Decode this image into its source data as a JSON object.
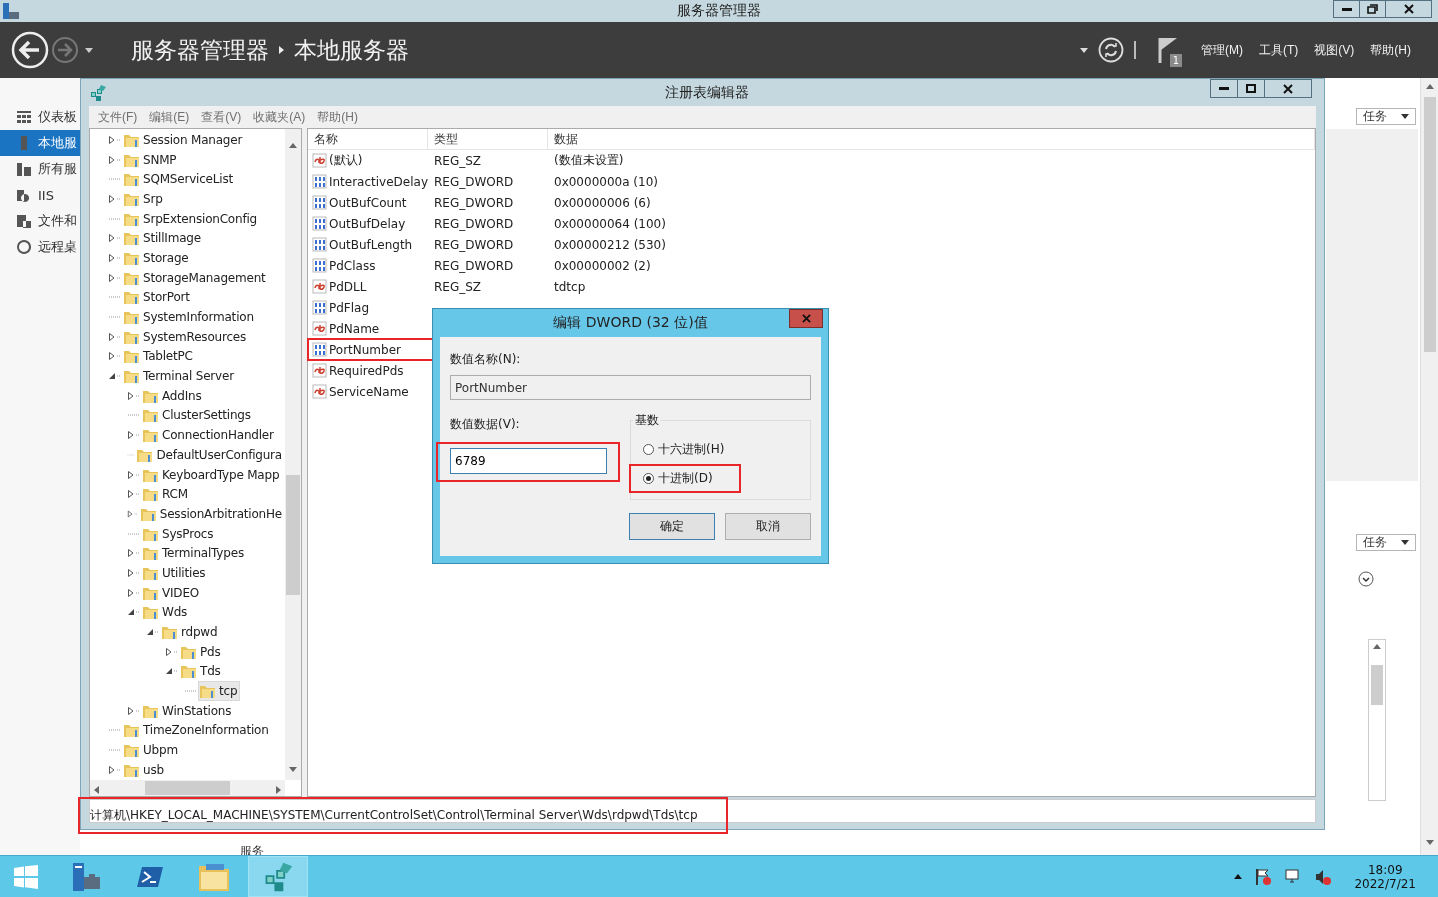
{
  "server_manager": {
    "title": "服务器管理器",
    "breadcrumb": [
      "服务器管理器",
      "本地服务器"
    ],
    "notifications": "1",
    "menu": [
      "管理(M)",
      "工具(T)",
      "视图(V)",
      "帮助(H)"
    ],
    "nav": [
      {
        "label": "仪表板",
        "kind": "dashboard",
        "selected": false
      },
      {
        "label": "本地服",
        "kind": "local",
        "selected": true
      },
      {
        "label": "所有服",
        "kind": "all",
        "selected": false
      },
      {
        "label": "IIS",
        "kind": "iis",
        "selected": false
      },
      {
        "label": "文件和",
        "kind": "files",
        "selected": false
      },
      {
        "label": "远程桌",
        "kind": "remote",
        "selected": false
      }
    ],
    "task_buttons": [
      "任务",
      "任务"
    ],
    "section_label": "服务"
  },
  "regedit": {
    "title": "注册表编辑器",
    "menu": [
      "文件(F)",
      "编辑(E)",
      "查看(V)",
      "收藏夹(A)",
      "帮助(H)"
    ],
    "tree": [
      {
        "name": "Session Manager",
        "has_children": true,
        "expanded": false,
        "selected": false
      },
      {
        "name": "SNMP",
        "has_children": true,
        "expanded": false,
        "selected": false
      },
      {
        "name": "SQMServiceList",
        "has_children": false,
        "expanded": false,
        "selected": false
      },
      {
        "name": "Srp",
        "has_children": true,
        "expanded": false,
        "selected": false
      },
      {
        "name": "SrpExtensionConfig",
        "has_children": false,
        "expanded": false,
        "selected": false
      },
      {
        "name": "StillImage",
        "has_children": true,
        "expanded": false,
        "selected": false
      },
      {
        "name": "Storage",
        "has_children": true,
        "expanded": false,
        "selected": false
      },
      {
        "name": "StorageManagement",
        "has_children": true,
        "expanded": false,
        "selected": false
      },
      {
        "name": "StorPort",
        "has_children": false,
        "expanded": false,
        "selected": false
      },
      {
        "name": "SystemInformation",
        "has_children": false,
        "expanded": false,
        "selected": false
      },
      {
        "name": "SystemResources",
        "has_children": true,
        "expanded": false,
        "selected": false
      },
      {
        "name": "TabletPC",
        "has_children": true,
        "expanded": false,
        "selected": false
      },
      {
        "name": "Terminal Server",
        "has_children": true,
        "expanded": true,
        "selected": false,
        "children": [
          {
            "name": "AddIns",
            "has_children": true,
            "expanded": false,
            "selected": false
          },
          {
            "name": "ClusterSettings",
            "has_children": false,
            "expanded": false,
            "selected": false
          },
          {
            "name": "ConnectionHandler",
            "has_children": true,
            "expanded": false,
            "selected": false
          },
          {
            "name": "DefaultUserConfigura",
            "has_children": false,
            "expanded": false,
            "selected": false
          },
          {
            "name": "KeyboardType Mapp",
            "has_children": true,
            "expanded": false,
            "selected": false
          },
          {
            "name": "RCM",
            "has_children": true,
            "expanded": false,
            "selected": false
          },
          {
            "name": "SessionArbitrationHe",
            "has_children": true,
            "expanded": false,
            "selected": false
          },
          {
            "name": "SysProcs",
            "has_children": false,
            "expanded": false,
            "selected": false
          },
          {
            "name": "TerminalTypes",
            "has_children": true,
            "expanded": false,
            "selected": false
          },
          {
            "name": "Utilities",
            "has_children": true,
            "expanded": false,
            "selected": false
          },
          {
            "name": "VIDEO",
            "has_children": true,
            "expanded": false,
            "selected": false
          },
          {
            "name": "Wds",
            "has_children": true,
            "expanded": true,
            "selected": false,
            "children": [
              {
                "name": "rdpwd",
                "has_children": true,
                "expanded": true,
                "selected": false,
                "children": [
                  {
                    "name": "Pds",
                    "has_children": true,
                    "expanded": false,
                    "selected": false
                  },
                  {
                    "name": "Tds",
                    "has_children": true,
                    "expanded": true,
                    "selected": false,
                    "children": [
                      {
                        "name": "tcp",
                        "has_children": false,
                        "expanded": false,
                        "selected": true
                      }
                    ]
                  }
                ]
              }
            ]
          },
          {
            "name": "WinStations",
            "has_children": true,
            "expanded": false,
            "selected": false
          }
        ]
      },
      {
        "name": "TimeZoneInformation",
        "has_children": false,
        "expanded": false,
        "selected": false
      },
      {
        "name": "Ubpm",
        "has_children": false,
        "expanded": false,
        "selected": false
      },
      {
        "name": "usb",
        "has_children": true,
        "expanded": false,
        "selected": false
      }
    ],
    "columns": [
      "名称",
      "类型",
      "数据"
    ],
    "values": [
      {
        "name": "(默认)",
        "kind": "string",
        "type": "REG_SZ",
        "data": "(数值未设置)",
        "highlighted": false
      },
      {
        "name": "InteractiveDelay",
        "kind": "dword",
        "type": "REG_DWORD",
        "data": "0x0000000a (10)",
        "highlighted": false
      },
      {
        "name": "OutBufCount",
        "kind": "dword",
        "type": "REG_DWORD",
        "data": "0x00000006 (6)",
        "highlighted": false
      },
      {
        "name": "OutBufDelay",
        "kind": "dword",
        "type": "REG_DWORD",
        "data": "0x00000064 (100)",
        "highlighted": false
      },
      {
        "name": "OutBufLength",
        "kind": "dword",
        "type": "REG_DWORD",
        "data": "0x00000212 (530)",
        "highlighted": false
      },
      {
        "name": "PdClass",
        "kind": "dword",
        "type": "REG_DWORD",
        "data": "0x00000002 (2)",
        "highlighted": false
      },
      {
        "name": "PdDLL",
        "kind": "string",
        "type": "REG_SZ",
        "data": "tdtcp",
        "highlighted": false
      },
      {
        "name": "PdFlag",
        "kind": "dword",
        "highlighted": false
      },
      {
        "name": "PdName",
        "kind": "string",
        "highlighted": false
      },
      {
        "name": "PortNumber",
        "kind": "dword",
        "highlighted": true
      },
      {
        "name": "RequiredPds",
        "kind": "string",
        "highlighted": false
      },
      {
        "name": "ServiceName",
        "kind": "string",
        "highlighted": false
      }
    ],
    "path": "计算机\\HKEY_LOCAL_MACHINE\\SYSTEM\\CurrentControlSet\\Control\\Terminal Server\\Wds\\rdpwd\\Tds\\tcp",
    "path_highlighted": true
  },
  "dialog": {
    "title": "编辑 DWORD (32 位)值",
    "name_label": "数值名称(N):",
    "name_value": "PortNumber",
    "data_label": "数值数据(V):",
    "data_value": "6789",
    "data_highlighted": true,
    "base_label": "基数",
    "bases": [
      {
        "label": "十六进制(H)",
        "selected": false,
        "highlighted": false
      },
      {
        "label": "十进制(D)",
        "selected": true,
        "highlighted": true
      }
    ],
    "buttons": [
      {
        "label": "确定",
        "default": true
      },
      {
        "label": "取消",
        "default": false
      }
    ]
  },
  "taskbar": {
    "apps": [
      {
        "kind": "server-manager",
        "active": false
      },
      {
        "kind": "powershell",
        "active": false
      },
      {
        "kind": "explorer",
        "active": false
      },
      {
        "kind": "regedit",
        "active": true
      }
    ],
    "time": "18:09",
    "date": "2022/7/21"
  }
}
